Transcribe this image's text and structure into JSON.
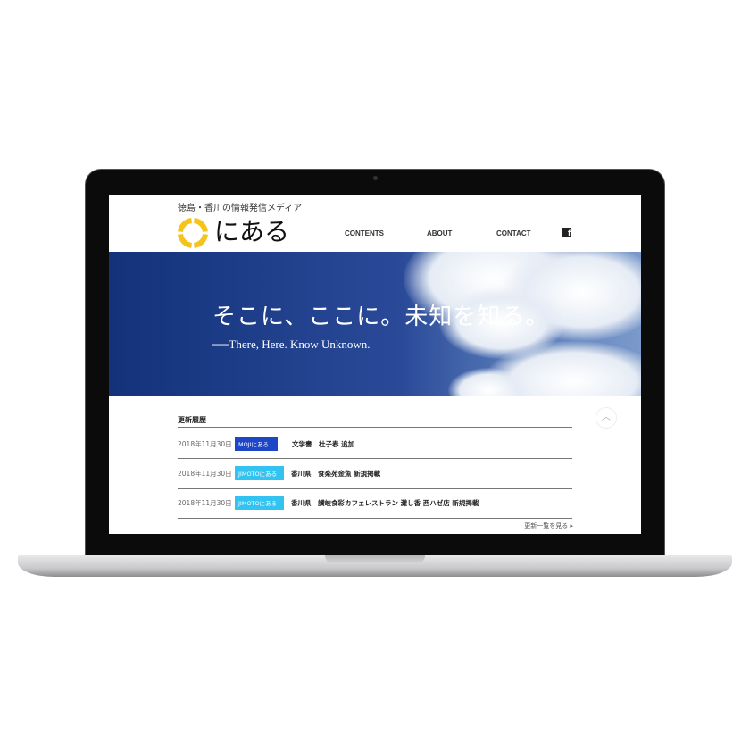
{
  "site": {
    "tagline": "徳島・香川の情報発信メディア",
    "logo": "にある",
    "brand_color": "#f6c31b"
  },
  "nav": {
    "items": [
      "CONTENTS",
      "ABOUT",
      "CONTACT"
    ],
    "facebook_icon": "facebook-icon"
  },
  "hero": {
    "title": "そこに、ここに。未知を知る。",
    "subtitle": "──There, Here. Know Unknown."
  },
  "updates": {
    "title": "更新履歴",
    "rows": [
      {
        "date": "2018年11月30日",
        "badge": "MOJIにある",
        "badge_color": "#1e47c8",
        "text": "文学書　杜子春 追加"
      },
      {
        "date": "2018年11月30日",
        "badge": "JIMOTOにある",
        "badge_color": "#33c3f0",
        "text": "香川県　食楽苑金魚 新規掲載"
      },
      {
        "date": "2018年11月30日",
        "badge": "JIMOTOにある",
        "badge_color": "#33c3f0",
        "text": "香川県　讃岐食彩カフェレストラン 灘し香 西ハゼ店 新規掲載"
      }
    ],
    "more": "更新一覧を見る ▸"
  }
}
